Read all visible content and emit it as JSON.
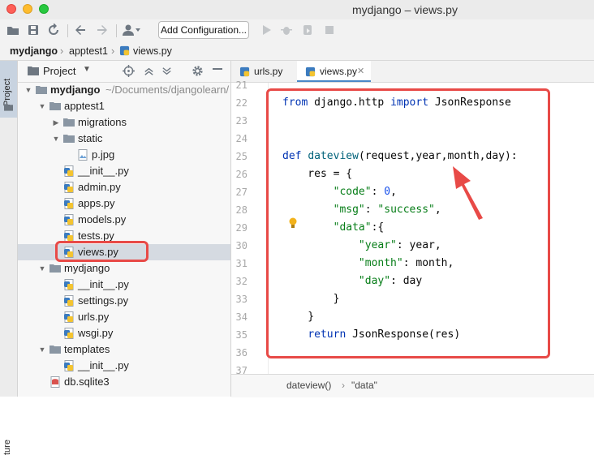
{
  "window": {
    "title": "mydjango – views.py"
  },
  "toolbar": {
    "add_config_label": "Add Configuration..."
  },
  "breadcrumb": {
    "items": [
      "mydjango",
      "apptest1",
      "views.py"
    ]
  },
  "sidebar_strip": {
    "project_tab": "Project",
    "structure_tab": "ture"
  },
  "project_panel": {
    "title": "Project",
    "tree": [
      {
        "label": "mydjango",
        "suffix": "~/Documents/djangolearn/",
        "depth": 0,
        "type": "folder",
        "expanded": true
      },
      {
        "label": "apptest1",
        "depth": 1,
        "type": "folder",
        "expanded": true
      },
      {
        "label": "migrations",
        "depth": 2,
        "type": "folder",
        "expanded": false
      },
      {
        "label": "static",
        "depth": 2,
        "type": "folder",
        "expanded": true
      },
      {
        "label": "p.jpg",
        "depth": 3,
        "type": "image"
      },
      {
        "label": "__init__.py",
        "depth": 2,
        "type": "python"
      },
      {
        "label": "admin.py",
        "depth": 2,
        "type": "python"
      },
      {
        "label": "apps.py",
        "depth": 2,
        "type": "python"
      },
      {
        "label": "models.py",
        "depth": 2,
        "type": "python"
      },
      {
        "label": "tests.py",
        "depth": 2,
        "type": "python"
      },
      {
        "label": "views.py",
        "depth": 2,
        "type": "python",
        "selected": true
      },
      {
        "label": "mydjango",
        "depth": 1,
        "type": "folder",
        "expanded": true
      },
      {
        "label": "__init__.py",
        "depth": 2,
        "type": "python"
      },
      {
        "label": "settings.py",
        "depth": 2,
        "type": "python"
      },
      {
        "label": "urls.py",
        "depth": 2,
        "type": "python"
      },
      {
        "label": "wsgi.py",
        "depth": 2,
        "type": "python"
      },
      {
        "label": "templates",
        "depth": 1,
        "type": "folder",
        "expanded": true
      },
      {
        "label": "__init__.py",
        "depth": 2,
        "type": "python"
      },
      {
        "label": "db.sqlite3",
        "depth": 1,
        "type": "db"
      }
    ]
  },
  "editor": {
    "tabs": [
      {
        "label": "urls.py",
        "active": false
      },
      {
        "label": "views.py",
        "active": true
      }
    ],
    "line_numbers": [
      "21",
      "22",
      "23",
      "24",
      "25",
      "26",
      "27",
      "28",
      "29",
      "30",
      "31",
      "32",
      "33",
      "34",
      "35",
      "36",
      "37"
    ],
    "code": {
      "l22": {
        "a": "from",
        "b": " django.http ",
        "c": "import",
        "d": " JsonResponse"
      },
      "l25": {
        "a": "def",
        "b": " ",
        "c": "dateview",
        "d": "(request,year,month,day):"
      },
      "l26": "    res = {",
      "l27": {
        "a": "        ",
        "b": "\"code\"",
        "c": ": ",
        "d": "0",
        "e": ","
      },
      "l28": {
        "a": "        ",
        "b": "\"msg\"",
        "c": ": ",
        "d": "\"success\"",
        "e": ","
      },
      "l29": {
        "a": "        ",
        "b": "\"data\"",
        "c": ":{"
      },
      "l30": {
        "a": "            ",
        "b": "\"year\"",
        "c": ": year,"
      },
      "l31": {
        "a": "            ",
        "b": "\"month\"",
        "c": ": month,"
      },
      "l32": {
        "a": "            ",
        "b": "\"day\"",
        "c": ": day"
      },
      "l33": "        }",
      "l34": "    }",
      "l35": {
        "a": "    ",
        "b": "return",
        "c": " JsonResponse(res)"
      }
    },
    "status_path": [
      "dateview()",
      "\"data\""
    ]
  },
  "colors": {
    "highlight": "#e84a47",
    "keyword": "#0033b3",
    "string": "#067d17",
    "number": "#1750eb"
  }
}
